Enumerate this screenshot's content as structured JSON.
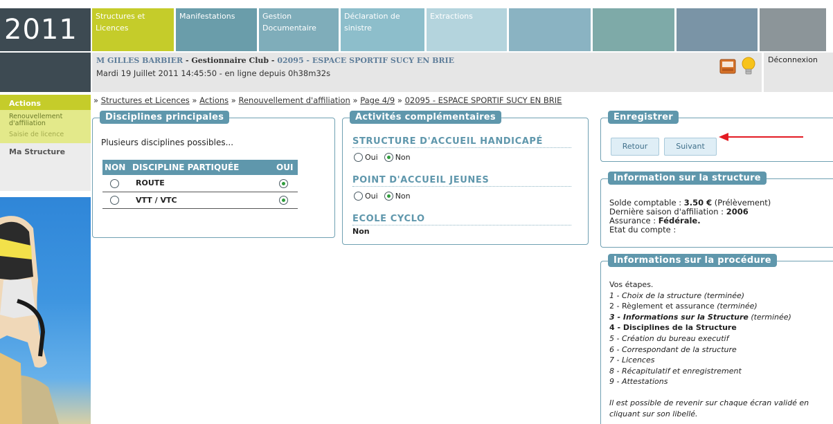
{
  "header": {
    "year": "2011",
    "tabs": [
      {
        "label": "Structures et Licences"
      },
      {
        "label": "Manifestations"
      },
      {
        "label": "Gestion Documentaire"
      },
      {
        "label": "Déclaration de sinistre"
      },
      {
        "label": "Extractions"
      },
      {
        "label": ""
      },
      {
        "label": ""
      },
      {
        "label": ""
      },
      {
        "label": ""
      }
    ]
  },
  "userbar": {
    "name": "M GILLES BARBIER",
    "sep1": " - ",
    "role": "Gestionnaire Club",
    "sep2": " - ",
    "club": "02095 - ESPACE SPORTIF SUCY EN BRIE",
    "datetime": "Mardi 19 Juillet 2011 14:45:50 - en ligne depuis 0h38m32s",
    "logout": "Déconnexion"
  },
  "sidebar": {
    "title": "Actions",
    "items": [
      {
        "label": "Renouvellement d'affiliation"
      },
      {
        "label": "Saisie de licence"
      }
    ],
    "section": "Ma Structure"
  },
  "breadcrumb": {
    "prefix": "» ",
    "items": [
      {
        "label": "Structures et Licences"
      },
      {
        "label": "Actions"
      },
      {
        "label": "Renouvellement d'affiliation"
      },
      {
        "label": "Page 4/9"
      },
      {
        "label": "02095 - ESPACE SPORTIF SUCY EN BRIE"
      }
    ],
    "sep": " » "
  },
  "disciplines": {
    "title": "Disciplines principales",
    "intro": "Plusieurs disciplines possibles...",
    "headers": {
      "non": "NON",
      "discipline": "DISCIPLINE PARTIQUÉE",
      "oui": "OUI"
    },
    "rows": [
      {
        "name": "ROUTE",
        "selected": "oui"
      },
      {
        "name": "VTT / VTC",
        "selected": "oui"
      }
    ]
  },
  "activites": {
    "title": "Activités complémentaires",
    "handicap": {
      "title": "STRUCTURE D'ACCUEIL HANDICAPÉ",
      "oui": "Oui",
      "non": "Non",
      "selected": "non"
    },
    "jeunes": {
      "title": "POINT D'ACCUEIL JEUNES",
      "oui": "Oui",
      "non": "Non",
      "selected": "non"
    },
    "cyclo": {
      "title": "ECOLE CYCLO",
      "value": "Non"
    }
  },
  "enregistrer": {
    "title": "Enregistrer",
    "back": "Retour",
    "next": "Suivant"
  },
  "structure_info": {
    "title": "Information sur la structure",
    "solde_label": "Solde comptable : ",
    "solde_value": "3.50 €",
    "solde_note": " (Prélèvement)",
    "saison_label": "Dernière saison d'affiliation : ",
    "saison_value": "2006",
    "assurance_label": "Assurance : ",
    "assurance_value": "Fédérale.",
    "etat_label": "Etat du compte :"
  },
  "procedure": {
    "title": "Informations sur la procédure",
    "intro": "Vos étapes.",
    "steps": [
      {
        "label": "1 - Choix de la structure",
        "status": " (terminée)"
      },
      {
        "label": "2 - Règlement et assurance",
        "status": " (terminée)"
      },
      {
        "label": "3 - Informations sur la Structure",
        "status": " (terminée)"
      },
      {
        "label": "4 - Disciplines de la Structure",
        "status": ""
      },
      {
        "label": "5 - Création du bureau executif",
        "status": ""
      },
      {
        "label": "6 - Correspondant de la structure",
        "status": ""
      },
      {
        "label": "7 - Licences",
        "status": ""
      },
      {
        "label": "8 - Récapitulatif et enregistrement",
        "status": ""
      },
      {
        "label": "9 - Attestations",
        "status": ""
      }
    ],
    "note": "Il est possible de revenir sur chaque écran validé en cliquant sur son libellé."
  },
  "colors": {
    "accent_lime": "#c5cc2a",
    "accent_teal": "#5f97ac",
    "dark_block": "#3d4a52",
    "annotation_arrow": "#e31b23"
  }
}
